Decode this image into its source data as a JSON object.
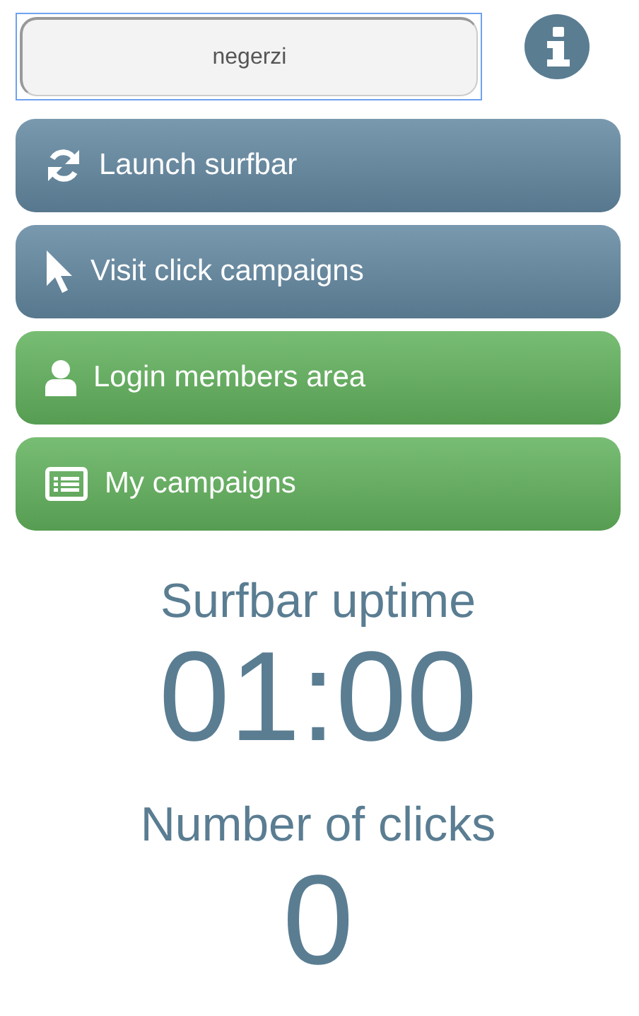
{
  "username_field": {
    "value": "negerzi"
  },
  "buttons": [
    {
      "label": "Launch surfbar",
      "kind": "refresh",
      "color": "#6388a1"
    },
    {
      "label": "Visit click campaigns",
      "kind": "pointer",
      "color": "#6388a1"
    },
    {
      "label": "Login members area",
      "kind": "user",
      "color": "#62b25d"
    },
    {
      "label": "My campaigns",
      "kind": "list",
      "color": "#62b25d"
    }
  ],
  "stats": [
    {
      "label": "Surfbar uptime",
      "value": "01:00"
    },
    {
      "label": "Number of clicks",
      "value": "0"
    }
  ]
}
